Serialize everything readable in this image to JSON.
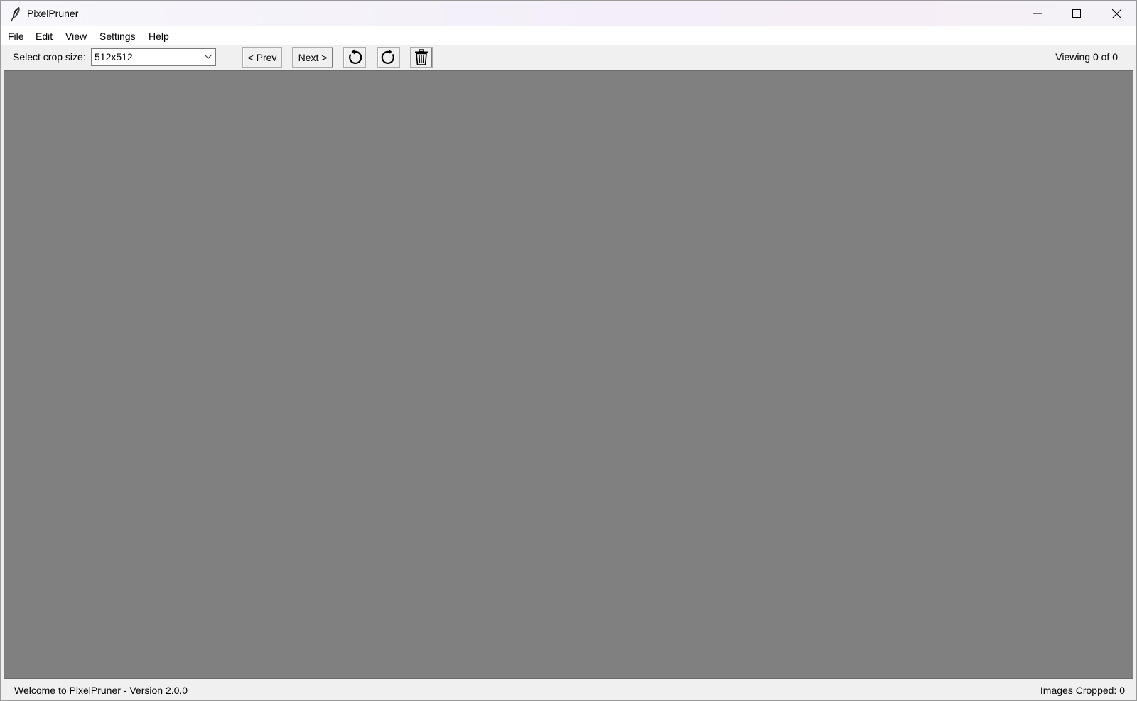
{
  "window": {
    "title": "PixelPruner",
    "icon": "feather-icon"
  },
  "menu": {
    "items": [
      "File",
      "Edit",
      "View",
      "Settings",
      "Help"
    ]
  },
  "toolbar": {
    "crop_label": "Select crop size:",
    "crop_value": "512x512",
    "prev_label": "< Prev",
    "next_label": "Next >",
    "rotate_left_icon": "rotate-left-icon",
    "rotate_right_icon": "rotate-right-icon",
    "delete_icon": "trash-icon",
    "viewing": "Viewing 0 of 0"
  },
  "canvas": {
    "background": "#808080"
  },
  "status": {
    "left": "Welcome to PixelPruner - Version 2.0.0",
    "right": "Images Cropped: 0"
  }
}
